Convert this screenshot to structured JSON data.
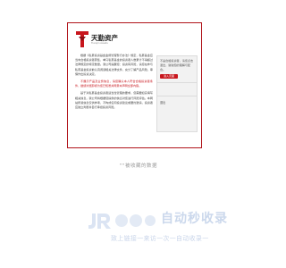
{
  "colors": {
    "brand_red": "#c8161d",
    "border_red": "#b0141b",
    "watermark_blue": "#cbd8ec"
  },
  "logo": {
    "name_cn": "天勤资产",
    "name_en": "Tianqin Assets"
  },
  "article": {
    "paragraphs": [
      {
        "style": "normal",
        "text": "根据《私募投资基金监督管理暂行办法》规定，私募基金应当向合格投资者募集，单只私募基金的投资者人数累计不得超过法律规定的特定数量。我公司提醒您：投资有风险，请您在参与私募基金投资前认真阅读相关法律文件，充分了解产品风险，审慎作出投资决定。"
      },
      {
        "style": "red",
        "text": "不展示产品及业务信息，请您确认本人符合合格投资者条件，继续浏览即视为您已知悉并同意本声明全部内容。"
      },
      {
        "style": "normal",
        "text": "基于对私募基金投资者适当性管理的要求，您需要如实填写相关信息，我公司将根据您提供的信息对您进行风险评估。本网站所载信息仅供参考，不构成任何投资建议或要约邀请，投资者应独立判断并自行承担投资风险。"
      }
    ]
  },
  "side": {
    "notice": "不是合格投资者，请您点击退出，谢谢您的理解与配合。",
    "confirm_button": "进入页面",
    "menu": [
      "",
      "退出"
    ]
  },
  "mid_text": "\"\"被收藏的数据",
  "watermark": {
    "icon": "jr-logo-icon",
    "title": "自动秒收录",
    "subtitle": "致上链接一来访一次一自动收录一"
  }
}
